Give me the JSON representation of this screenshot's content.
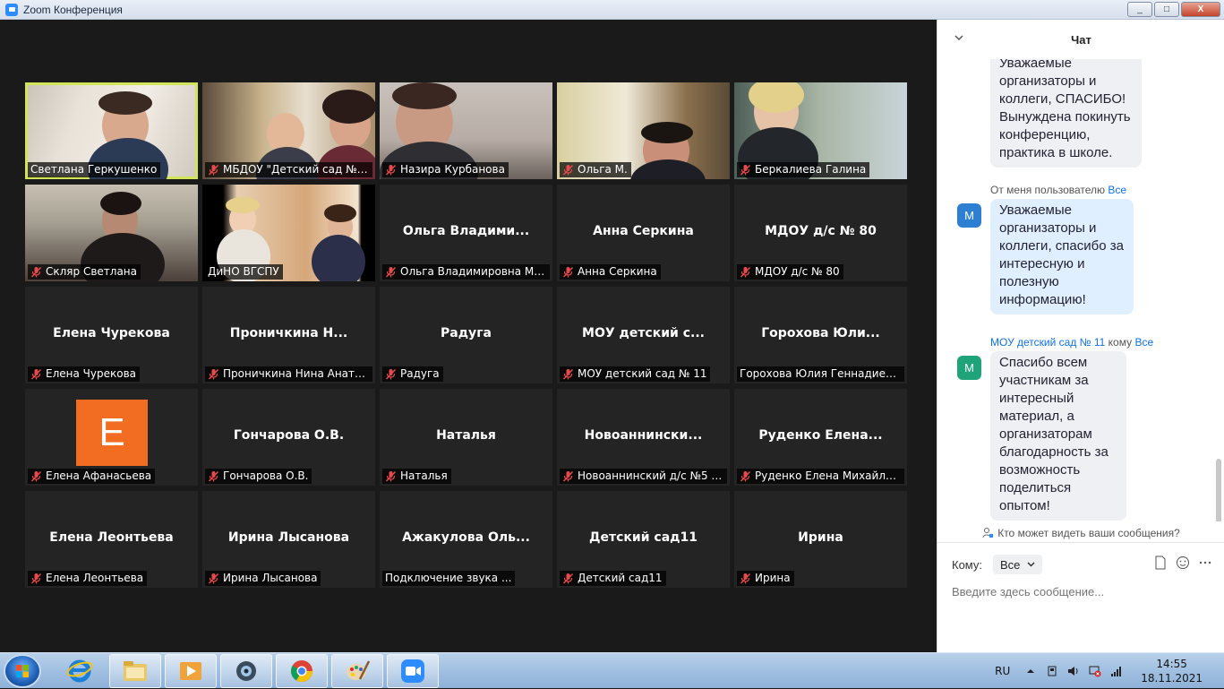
{
  "window": {
    "title": "Zoom Конференция",
    "controls": {
      "minimize": "_",
      "maximize": "□",
      "close": "X"
    }
  },
  "participants": [
    {
      "label": "Светлана Геркушенко",
      "video": "v1",
      "active": true,
      "muted": false
    },
    {
      "label": "МБДОУ \"Детский сад №5 ...",
      "video": "v2",
      "muted": true
    },
    {
      "label": "Назира Курбанова",
      "video": "v3",
      "muted": true
    },
    {
      "label": "Ольга М.",
      "video": "v4",
      "muted": true
    },
    {
      "label": "Беркалиева Галина",
      "video": "v5",
      "muted": true
    },
    {
      "label": "Скляр Светлана",
      "video": "v6",
      "muted": true
    },
    {
      "label": "ДиНО ВГСПУ",
      "video": "v7",
      "muted": false
    },
    {
      "display": "Ольга  Владими...",
      "label": "Ольга Владимировна Мат...",
      "muted": true
    },
    {
      "display": "Анна Серкина",
      "label": "Анна Серкина",
      "muted": true
    },
    {
      "display": "МДОУ д/с № 80",
      "label": "МДОУ д/с № 80",
      "muted": true
    },
    {
      "display": "Елена Чурекова",
      "label": "Елена Чурекова",
      "muted": true
    },
    {
      "display": "Проничкина  Н...",
      "label": "Проничкина Нина Анатол...",
      "muted": true
    },
    {
      "display": "Радуга",
      "label": "Радуга",
      "muted": true
    },
    {
      "display": "МОУ  детский  с...",
      "label": "МОУ детский сад № 11",
      "muted": true
    },
    {
      "display": "Горохова  Юли...",
      "label": "Горохова Юлия Геннадиевна...",
      "muted": false
    },
    {
      "avatar_letter": "E",
      "avatar_color": "#f26d21",
      "label": "Елена Афанасьева",
      "muted": true
    },
    {
      "display": "Гончарова О.В.",
      "label": "Гончарова О.В.",
      "muted": true
    },
    {
      "display": "Наталья",
      "label": "Наталья",
      "muted": true
    },
    {
      "display": "Новоаннински...",
      "label": "Новоаннинский д/с №5 В...",
      "muted": true
    },
    {
      "display": "Руденко  Елена...",
      "label": "Руденко Елена Михайловна",
      "muted": true
    },
    {
      "display": "Елена Леонтьева",
      "label": "Елена Леонтьева",
      "muted": true
    },
    {
      "display": "Ирина Лысанова",
      "label": "Ирина Лысанова",
      "muted": true
    },
    {
      "display": "Ажакулова  Оль...",
      "label": "Подключение звука ...",
      "muted": false
    },
    {
      "display": "Детский сад11",
      "label": "Детский сад11",
      "muted": true
    },
    {
      "display": "Ирина",
      "label": "Ирина",
      "muted": true
    }
  ],
  "chat": {
    "title": "Чат",
    "messages": [
      {
        "text": "Уважаемые организаторы и коллеги, СПАСИБО! Вынуждена покинуть конференцию, практика в школе."
      },
      {
        "meta_sender": "От меня пользователю",
        "meta_recipient": "Все",
        "avatar": "M",
        "avatar_color": "#2d7fd3",
        "text": "Уважаемые организаторы и коллеги, спасибо за интересную и полезную информацию!"
      },
      {
        "meta_sender": "МОУ детский сад № 11",
        "meta_mid": "кому",
        "meta_recipient": "Все",
        "avatar": "M",
        "avatar_color": "#1fa47a",
        "text": "Спасибо всем участникам за интересный материал, а организаторам благодарность за возможность поделиться опытом!"
      }
    ],
    "privacy_text": "Кто может видеть ваши сообщения?",
    "to_label": "Кому:",
    "to_value": "Все",
    "input_placeholder": "Введите здесь сообщение..."
  },
  "taskbar": {
    "language": "RU",
    "time": "14:55",
    "date": "18.11.2021",
    "apps": [
      "explorer",
      "media-player",
      "webcam-app",
      "chrome",
      "paint",
      "zoom"
    ]
  }
}
